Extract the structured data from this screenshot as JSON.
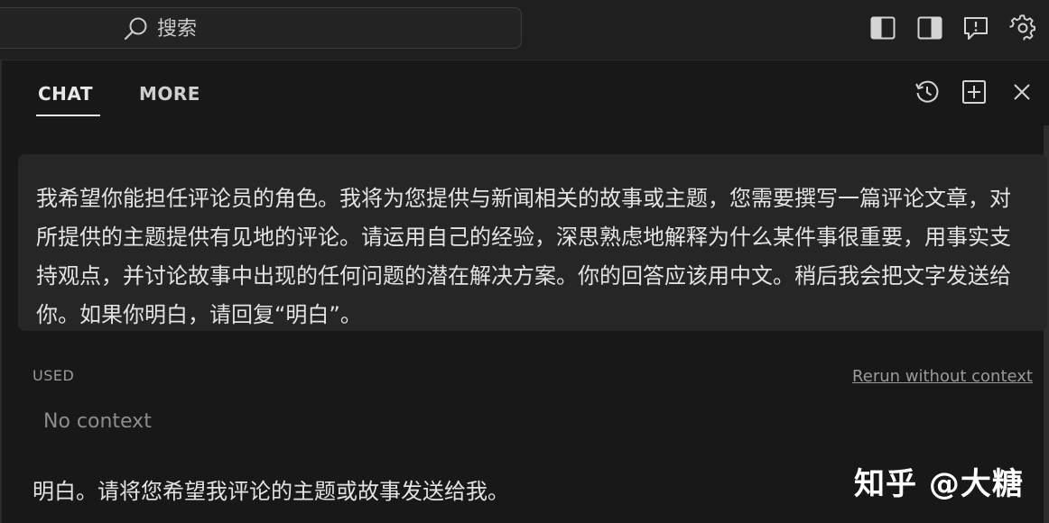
{
  "titlebar": {
    "search_placeholder": "搜索",
    "icons": [
      "toggle-primary-sidebar-icon",
      "toggle-secondary-sidebar-icon",
      "feedback-icon",
      "gear-icon"
    ]
  },
  "panel": {
    "tabs": [
      {
        "label": "CHAT",
        "active": true
      },
      {
        "label": "MORE",
        "active": false
      }
    ],
    "header_icons": [
      "history-icon",
      "new-chat-icon",
      "close-icon"
    ]
  },
  "chat": {
    "user_message": "我希望你能担任评论员的角色。我将为您提供与新闻相关的故事或主题，您需要撰写一篇评论文章，对所提供的主题提供有见地的评论。请运用自己的经验，深思熟虑地解释为什么某件事很重要，用事实支持观点，并讨论故事中出现的任何问题的潜在解决方案。你的回答应该用中文。稍后我会把文字发送给你。如果你明白，请回复“明白”。",
    "used_label": "USED",
    "rerun_label": "Rerun without context",
    "context_value": "No context",
    "assistant_reply": "明白。请将您希望我评论的主题或故事发送给我。"
  },
  "watermark": "知乎 @大糖",
  "colors": {
    "background": "#181818",
    "bubble": "#262626",
    "text": "#e3e3e3",
    "muted": "#9a9a9a"
  }
}
